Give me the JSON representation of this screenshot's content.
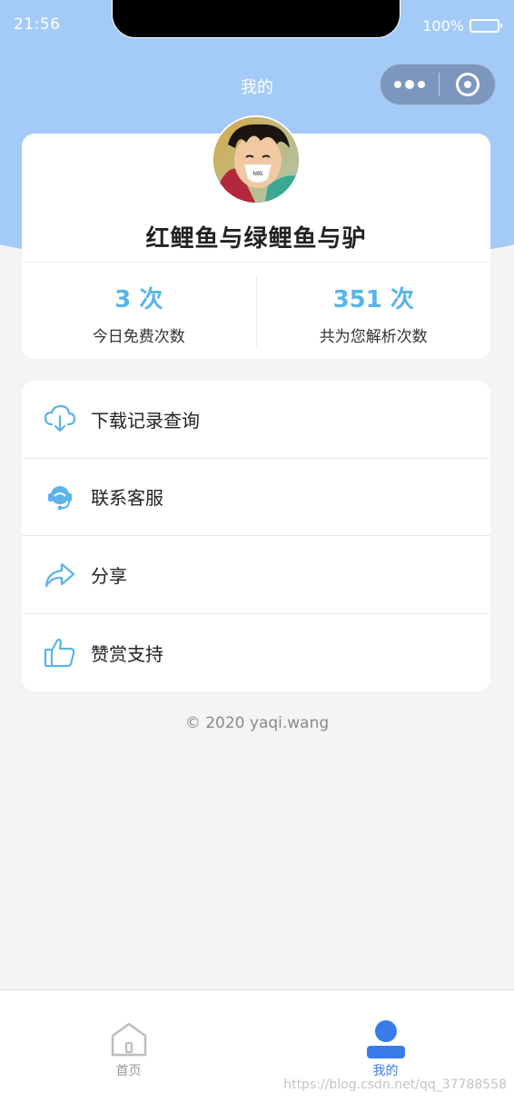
{
  "status_bar": {
    "time": "21:56",
    "battery": "100%"
  },
  "nav": {
    "title": "我的"
  },
  "profile": {
    "username": "红鲤鱼与绿鲤鱼与驴",
    "stats": [
      {
        "value": "3 次",
        "label": "今日免费次数"
      },
      {
        "value": "351 次",
        "label": "共为您解析次数"
      }
    ]
  },
  "menu": {
    "items": [
      {
        "label": "下载记录查询",
        "icon": "cloud-download-icon"
      },
      {
        "label": "联系客服",
        "icon": "customer-service-icon"
      },
      {
        "label": "分享",
        "icon": "share-icon"
      },
      {
        "label": "赞赏支持",
        "icon": "thumbs-up-icon"
      }
    ]
  },
  "footer": {
    "copyright": "© 2020 yaqi.wang"
  },
  "tabbar": {
    "tabs": [
      {
        "label": "首页",
        "icon": "home-icon",
        "active": false
      },
      {
        "label": "我的",
        "icon": "user-icon",
        "active": true
      }
    ]
  },
  "watermark": "https://blog.csdn.net/qq_37788558",
  "colors": {
    "header_blue": "#a4cbf8",
    "accent_blue": "#5ab4ea",
    "tab_active": "#3a7bea"
  }
}
